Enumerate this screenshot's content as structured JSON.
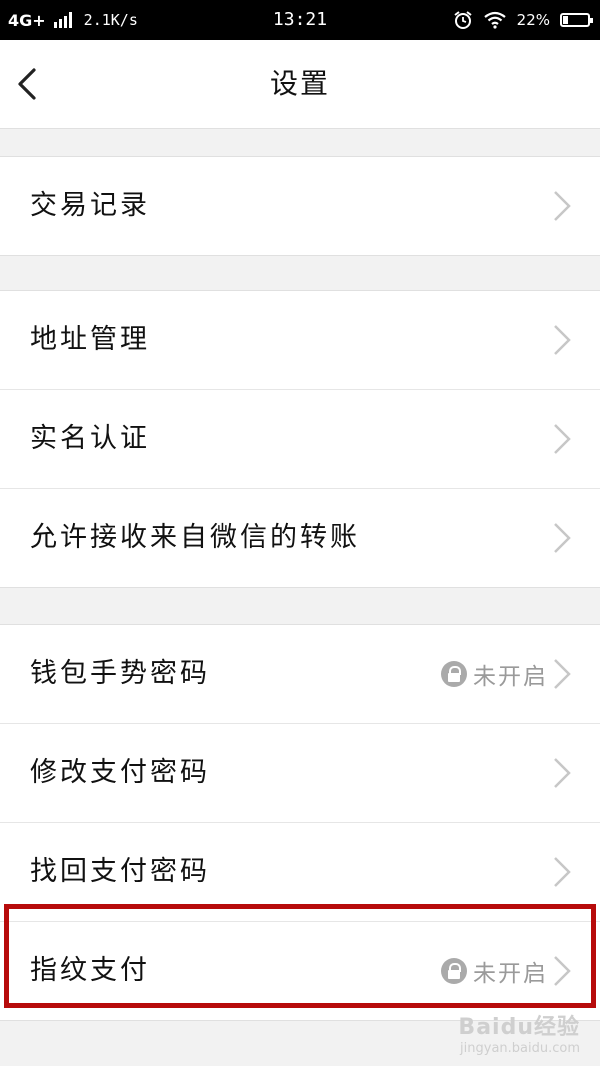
{
  "status_bar": {
    "network": "4G+",
    "speed": "2.1K/s",
    "time": "13:21",
    "battery": "22%",
    "battery_level": 0.22
  },
  "nav": {
    "title": "设置"
  },
  "groups": [
    {
      "rows": [
        {
          "label": "交易记录"
        }
      ]
    },
    {
      "rows": [
        {
          "label": "地址管理"
        },
        {
          "label": "实名认证"
        },
        {
          "label": "允许接收来自微信的转账"
        }
      ]
    },
    {
      "rows": [
        {
          "label": "钱包手势密码",
          "status": "未开启"
        },
        {
          "label": "修改支付密码"
        },
        {
          "label": "找回支付密码"
        },
        {
          "label": "指纹支付",
          "status": "未开启"
        }
      ]
    }
  ],
  "watermark": {
    "main": "Baidu经验",
    "sub": "jingyan.baidu.com"
  },
  "colors": {
    "highlight": "#b70b0b",
    "status_text": "#9a9a9a"
  }
}
